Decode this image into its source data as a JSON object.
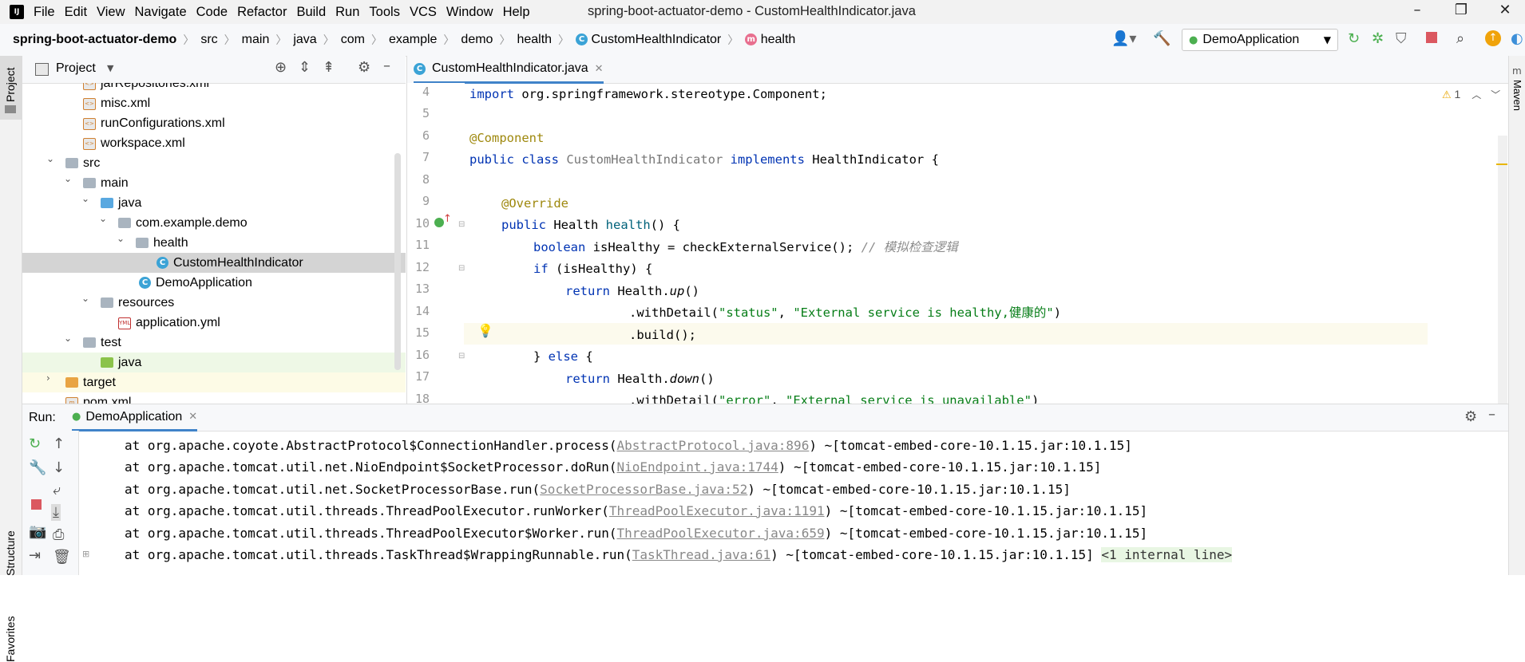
{
  "menu": {
    "logo": "IJ",
    "items": [
      "File",
      "Edit",
      "View",
      "Navigate",
      "Code",
      "Refactor",
      "Build",
      "Run",
      "Tools",
      "VCS",
      "Window",
      "Help"
    ],
    "window_title": "spring-boot-actuator-demo - CustomHealthIndicator.java"
  },
  "navbar": {
    "project": "spring-boot-actuator-demo",
    "crumbs": [
      "src",
      "main",
      "java",
      "com",
      "example",
      "demo",
      "health"
    ],
    "class_crumb": "CustomHealthIndicator",
    "method_crumb": "health",
    "run_config": "DemoApplication"
  },
  "project_panel": {
    "title": "Project",
    "side_label": "Project",
    "rows": [
      {
        "label": "jarRepositories.xml",
        "icon": "xml"
      },
      {
        "label": "misc.xml",
        "icon": "xml"
      },
      {
        "label": "runConfigurations.xml",
        "icon": "xml"
      },
      {
        "label": "workspace.xml",
        "icon": "xml"
      },
      {
        "label": "src",
        "icon": "folder"
      },
      {
        "label": "main",
        "icon": "folder"
      },
      {
        "label": "java",
        "icon": "folder-blue"
      },
      {
        "label": "com.example.demo",
        "icon": "package"
      },
      {
        "label": "health",
        "icon": "package"
      },
      {
        "label": "CustomHealthIndicator",
        "icon": "class"
      },
      {
        "label": "DemoApplication",
        "icon": "class"
      },
      {
        "label": "resources",
        "icon": "folder"
      },
      {
        "label": "application.yml",
        "icon": "yml"
      },
      {
        "label": "test",
        "icon": "folder"
      },
      {
        "label": "java",
        "icon": "folder-green"
      },
      {
        "label": "target",
        "icon": "folder-orange"
      },
      {
        "label": "pom.xml",
        "icon": "xml"
      }
    ]
  },
  "editor": {
    "tab": "CustomHealthIndicator.java",
    "warning_count": "1",
    "right_stripe_label": "Maven",
    "line_numbers": [
      "4",
      "5",
      "6",
      "7",
      "8",
      "9",
      "10",
      "11",
      "12",
      "13",
      "14",
      "15",
      "16",
      "17",
      "18"
    ],
    "code": {
      "l4a": "import",
      "l4b": " org.springframework.stereotype.Component;",
      "l6": "@Component",
      "l7a": "public class",
      "l7b": " CustomHealthIndicator",
      "l7c": " implements",
      "l7d": " HealthIndicator {",
      "l9": "@Override",
      "l10a": "public",
      "l10b": " Health ",
      "l10c": "health",
      "l10d": "() {",
      "l11a": "boolean",
      "l11b": " isHealthy = checkExternalService(); ",
      "l11c": "// 模拟检查逻辑",
      "l12a": "if",
      "l12b": " (isHealthy) {",
      "l13a": "return",
      "l13b": " Health.",
      "l13c": "up",
      "l13d": "()",
      "l14a": ".withDetail(",
      "l14b": "\"status\"",
      "l14c": ", ",
      "l14d": "\"External service is healthy,健康的\"",
      "l14e": ")",
      "l15": ".build();",
      "l16a": "} ",
      "l16b": "else",
      "l16c": " {",
      "l17a": "return",
      "l17b": " Health.",
      "l17c": "down",
      "l17d": "()",
      "l18a": ".withDetail(",
      "l18b": "\"error\"",
      "l18c": ", ",
      "l18d": "\"External service is unavailable\"",
      "l18e": ")"
    }
  },
  "run_panel": {
    "label": "Run:",
    "tab": "DemoApplication",
    "side_labels": [
      "Structure",
      "Favorites"
    ],
    "lines": [
      {
        "pre": "at org.apache.coyote.AbstractProtocol$ConnectionHandler.process(",
        "link": "AbstractProtocol.java:896",
        "post": ") ~[tomcat-embed-core-10.1.15.jar:10.1.15]",
        "extra": ""
      },
      {
        "pre": "at org.apache.tomcat.util.net.NioEndpoint$SocketProcessor.doRun(",
        "link": "NioEndpoint.java:1744",
        "post": ") ~[tomcat-embed-core-10.1.15.jar:10.1.15]",
        "extra": ""
      },
      {
        "pre": "at org.apache.tomcat.util.net.SocketProcessorBase.run(",
        "link": "SocketProcessorBase.java:52",
        "post": ") ~[tomcat-embed-core-10.1.15.jar:10.1.15]",
        "extra": ""
      },
      {
        "pre": "at org.apache.tomcat.util.threads.ThreadPoolExecutor.runWorker(",
        "link": "ThreadPoolExecutor.java:1191",
        "post": ") ~[tomcat-embed-core-10.1.15.jar:10.1.15]",
        "extra": ""
      },
      {
        "pre": "at org.apache.tomcat.util.threads.ThreadPoolExecutor$Worker.run(",
        "link": "ThreadPoolExecutor.java:659",
        "post": ") ~[tomcat-embed-core-10.1.15.jar:10.1.15]",
        "extra": ""
      },
      {
        "pre": "at org.apache.tomcat.util.threads.TaskThread$WrappingRunnable.run(",
        "link": "TaskThread.java:61",
        "post": ") ~[tomcat-embed-core-10.1.15.jar:10.1.15]",
        "extra": "<1 internal line>"
      }
    ]
  }
}
